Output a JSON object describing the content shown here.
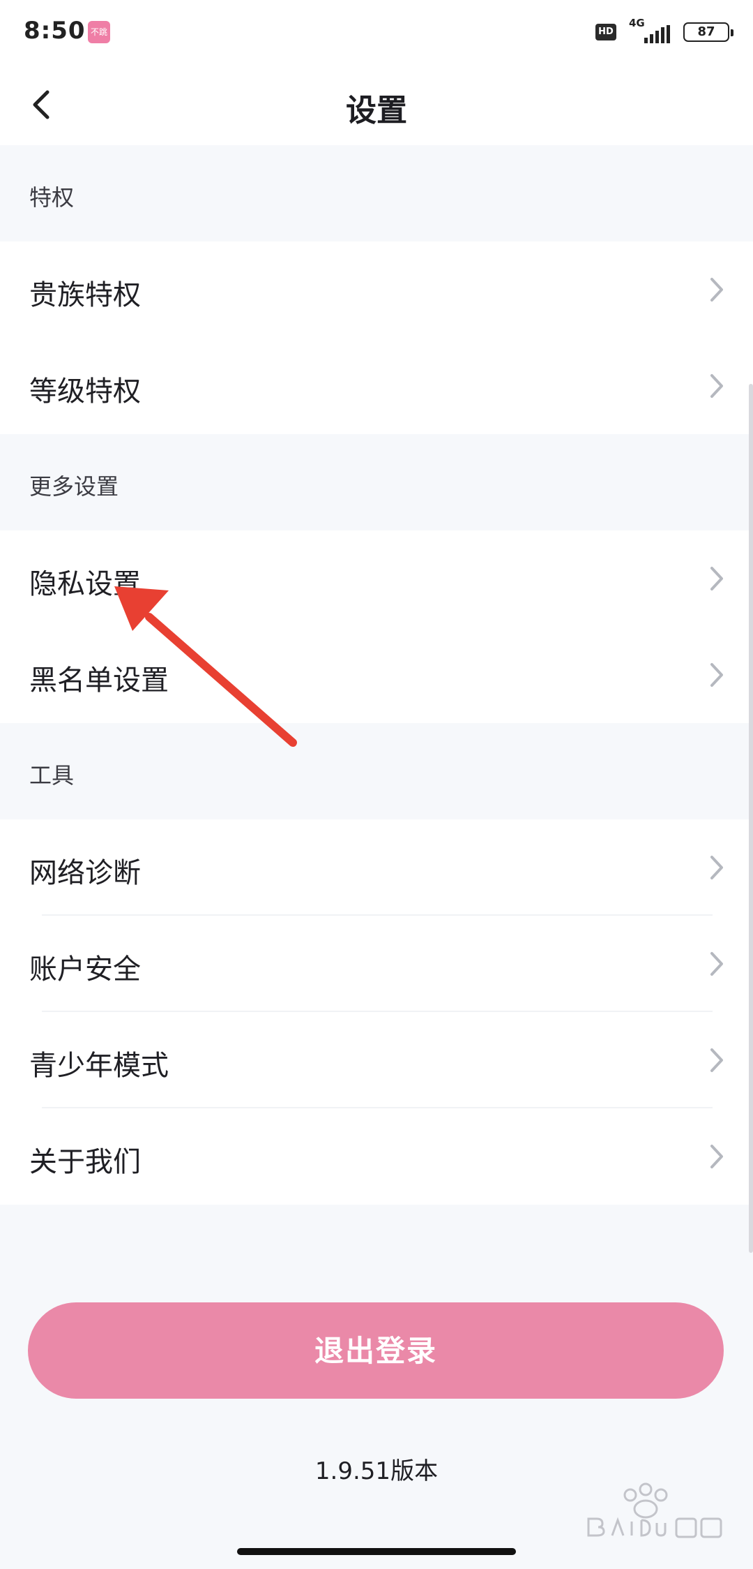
{
  "status_bar": {
    "time": "8:50",
    "notification_app": "不跳",
    "hd": "HD",
    "network": "4G",
    "battery": "87"
  },
  "header": {
    "title": "设置"
  },
  "sections": [
    {
      "title": "特权",
      "items": [
        "贵族特权",
        "等级特权"
      ]
    },
    {
      "title": "更多设置",
      "items": [
        "隐私设置",
        "黑名单设置"
      ]
    },
    {
      "title": "工具",
      "items": [
        "网络诊断",
        "账户安全",
        "青少年模式",
        "关于我们"
      ]
    }
  ],
  "logout": {
    "label": "退出登录"
  },
  "footer": {
    "version": "1.9.51版本"
  },
  "colors": {
    "accent": "#ea89a8",
    "background": "#f6f8fb",
    "annotation": "#e84032"
  },
  "icons": {
    "back": "back-arrow-icon",
    "chevron": "chevron-right-icon",
    "watermark": "baidu-watermark-icon"
  }
}
